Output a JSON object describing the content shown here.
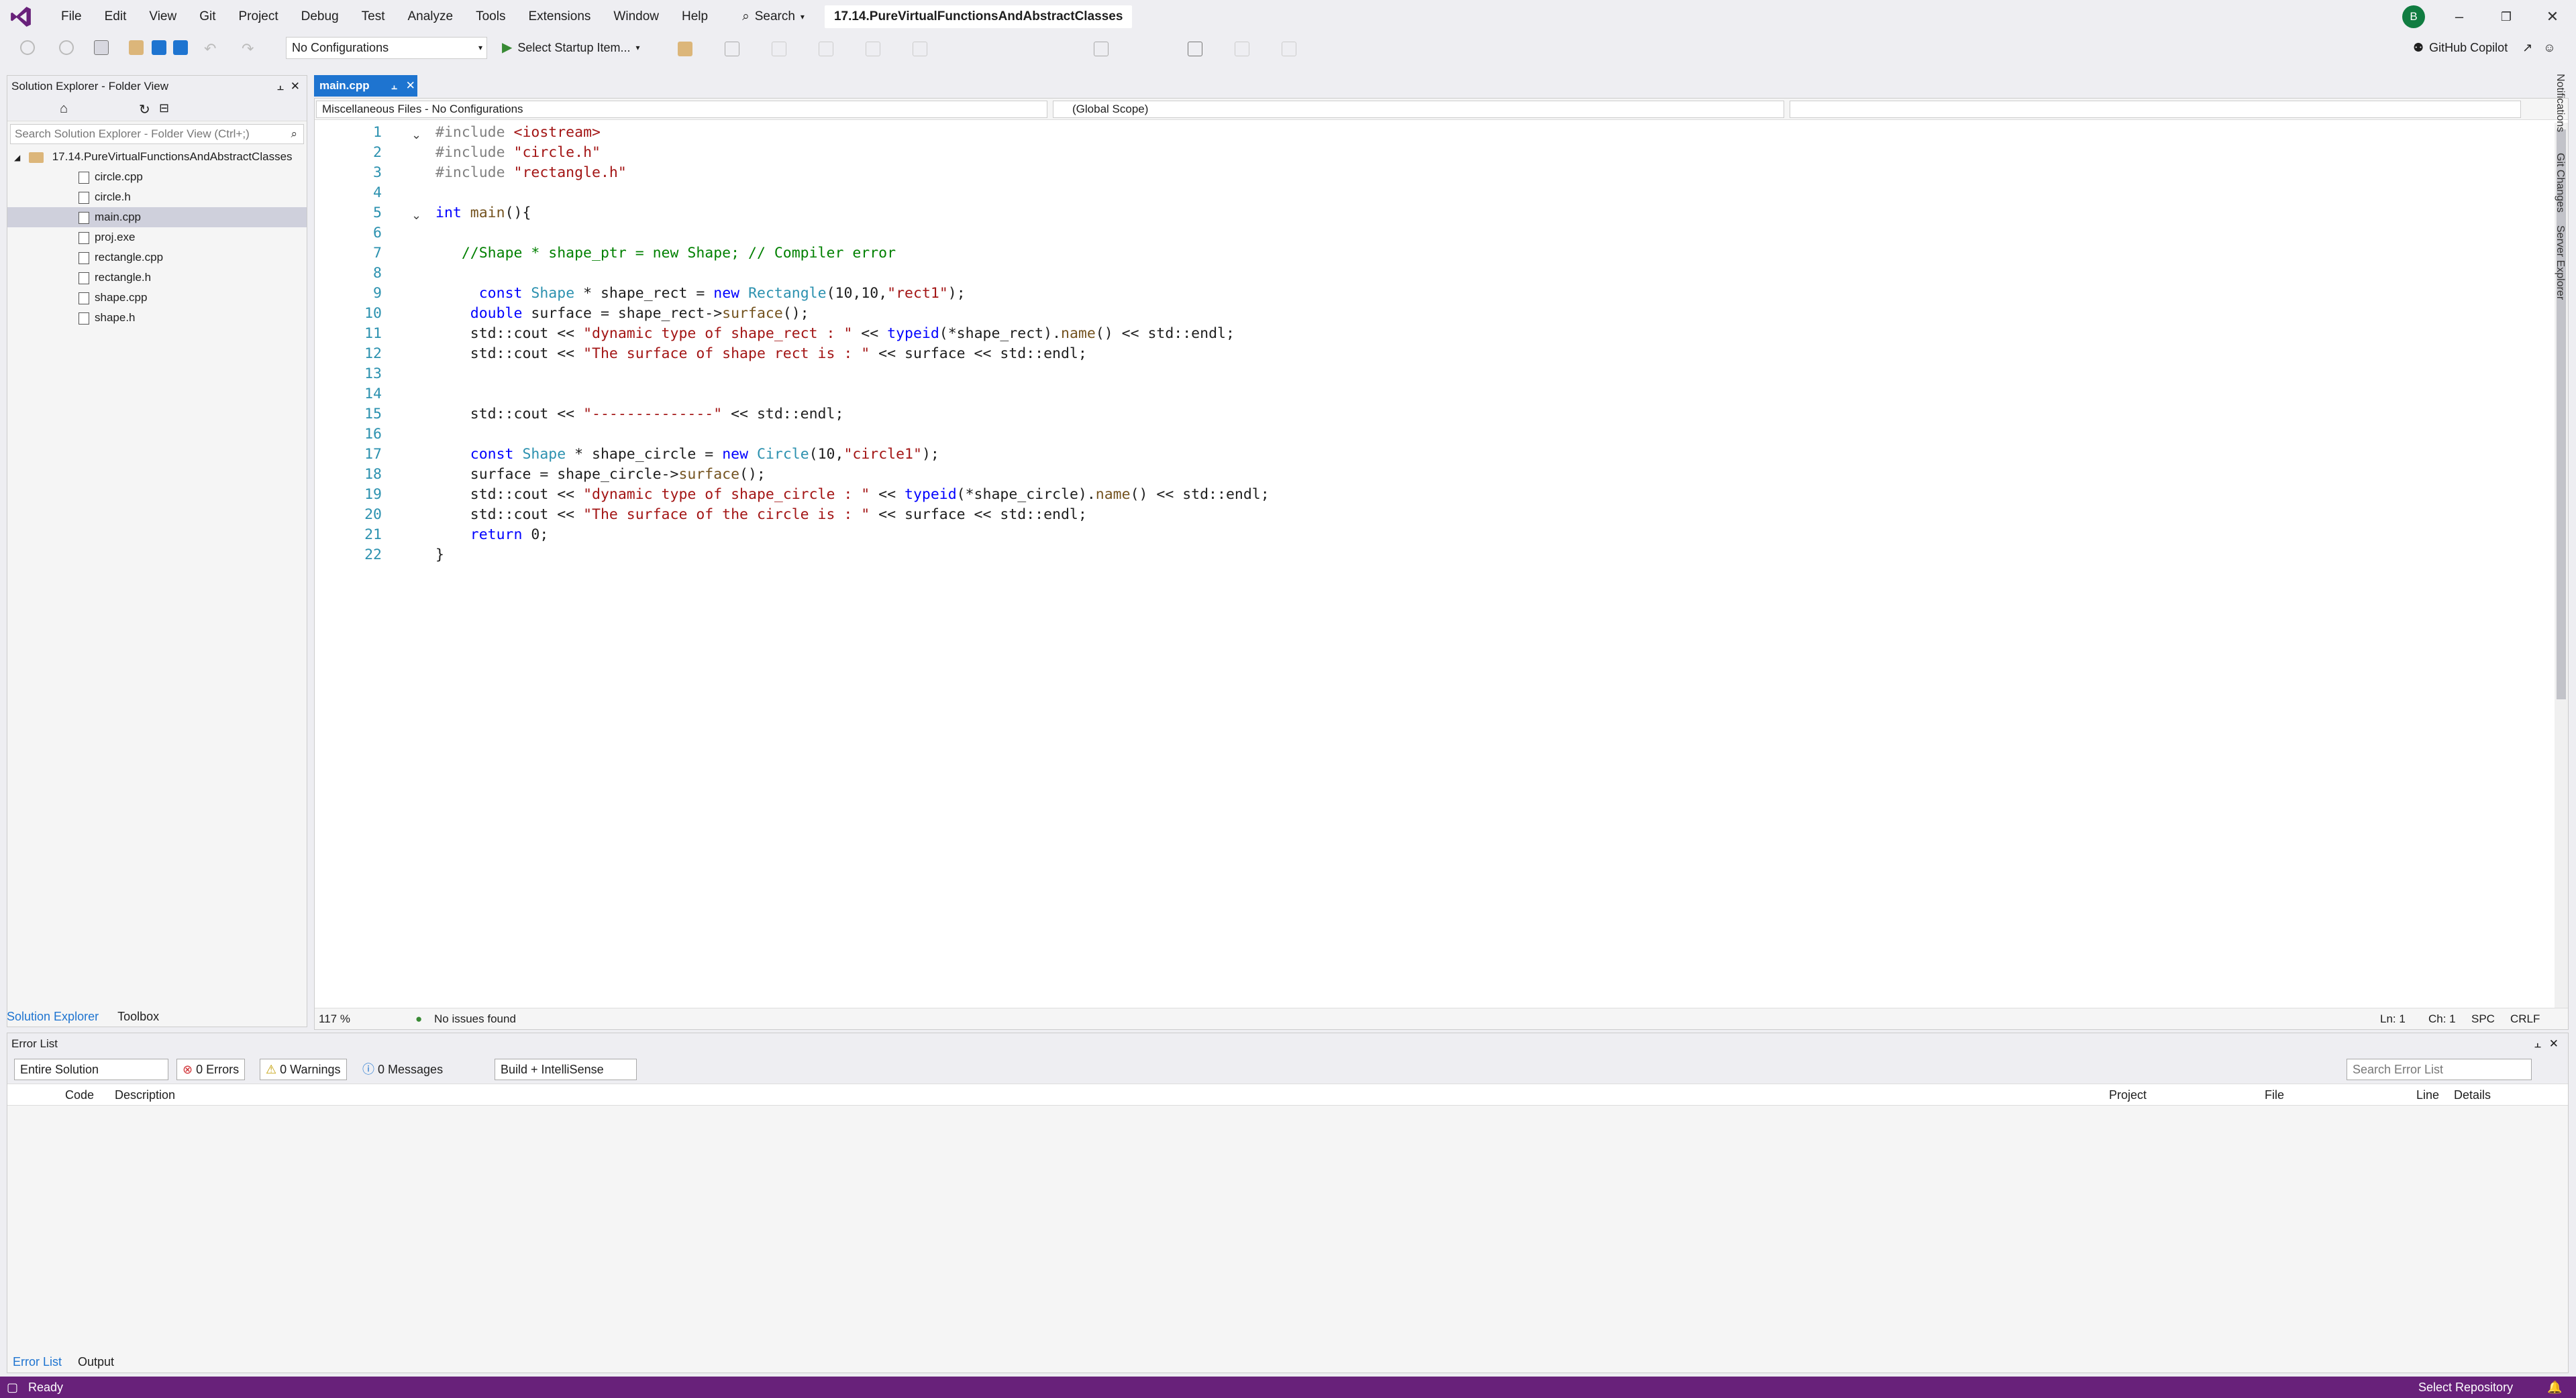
{
  "menu": {
    "items": [
      "File",
      "Edit",
      "View",
      "Git",
      "Project",
      "Debug",
      "Test",
      "Analyze",
      "Tools",
      "Extensions",
      "Window",
      "Help"
    ],
    "search_label": "Search",
    "solution_title": "17.14.PureVirtualFunctionsAndAbstractClasses",
    "avatar_initial": "B"
  },
  "toolbar": {
    "configuration": "No Configurations",
    "startup_label": "Select Startup Item...",
    "copilot_label": "GitHub Copilot"
  },
  "solution_explorer": {
    "title": "Solution Explorer - Folder View",
    "search_placeholder": "Search Solution Explorer - Folder View (Ctrl+;)",
    "root": "17.14.PureVirtualFunctionsAndAbstractClasses",
    "files": [
      {
        "name": "circle.cpp",
        "icon": "cpp-file-icon",
        "selected": false
      },
      {
        "name": "circle.h",
        "icon": "header-file-icon",
        "selected": false
      },
      {
        "name": "main.cpp",
        "icon": "cpp-file-icon",
        "selected": true
      },
      {
        "name": "proj.exe",
        "icon": "exe-file-icon",
        "selected": false
      },
      {
        "name": "rectangle.cpp",
        "icon": "cpp-file-icon",
        "selected": false
      },
      {
        "name": "rectangle.h",
        "icon": "header-file-icon",
        "selected": false
      },
      {
        "name": "shape.cpp",
        "icon": "cpp-file-icon",
        "selected": false
      },
      {
        "name": "shape.h",
        "icon": "header-file-icon",
        "selected": false
      }
    ],
    "bottom_tabs": [
      "Solution Explorer",
      "Toolbox"
    ]
  },
  "editor": {
    "tab_label": "main.cpp",
    "nav_project": "Miscellaneous Files - No Configurations",
    "nav_scope": "(Global Scope)",
    "nav_member": "",
    "lines": [
      {
        "n": "1",
        "html": "<span class=\"pp\">#include</span> <span class=\"str\">&lt;iostream&gt;</span>"
      },
      {
        "n": "2",
        "html": "<span class=\"pp\">#include</span> <span class=\"str\">\"circle.h\"</span>"
      },
      {
        "n": "3",
        "html": "<span class=\"pp\">#include</span> <span class=\"str\">\"rectangle.h\"</span>"
      },
      {
        "n": "4",
        "html": ""
      },
      {
        "n": "5",
        "html": "<span class=\"kw\">int</span> <span class=\"fn\">main</span>(){"
      },
      {
        "n": "6",
        "html": ""
      },
      {
        "n": "7",
        "html": "   <span class=\"cm\">//Shape * shape_ptr = new Shape; // Compiler error</span>"
      },
      {
        "n": "8",
        "html": ""
      },
      {
        "n": "9",
        "html": "     <span class=\"kw\">const</span> <span class=\"ty\">Shape</span> * shape_rect = <span class=\"kw\">new</span> <span class=\"ty\">Rectangle</span>(10,10,<span class=\"str\">\"rect1\"</span>);"
      },
      {
        "n": "10",
        "html": "    <span class=\"kw\">double</span> surface = shape_rect-&gt;<span class=\"fn\">surface</span>();"
      },
      {
        "n": "11",
        "html": "    std::cout &lt;&lt; <span class=\"str\">\"dynamic type of shape_rect : \"</span> &lt;&lt; <span class=\"kw\">typeid</span>(*shape_rect).<span class=\"fn\">name</span>() &lt;&lt; std::endl;"
      },
      {
        "n": "12",
        "html": "    std::cout &lt;&lt; <span class=\"str\">\"The surface of shape rect is : \"</span> &lt;&lt; surface &lt;&lt; std::endl;"
      },
      {
        "n": "13",
        "html": ""
      },
      {
        "n": "14",
        "html": ""
      },
      {
        "n": "15",
        "html": "    std::cout &lt;&lt; <span class=\"str\">\"--------------\"</span> &lt;&lt; std::endl;"
      },
      {
        "n": "16",
        "html": ""
      },
      {
        "n": "17",
        "html": "    <span class=\"kw\">const</span> <span class=\"ty\">Shape</span> * shape_circle = <span class=\"kw\">new</span> <span class=\"ty\">Circle</span>(10,<span class=\"str\">\"circle1\"</span>);"
      },
      {
        "n": "18",
        "html": "    surface = shape_circle-&gt;<span class=\"fn\">surface</span>();"
      },
      {
        "n": "19",
        "html": "    std::cout &lt;&lt; <span class=\"str\">\"dynamic type of shape_circle : \"</span> &lt;&lt; <span class=\"kw\">typeid</span>(*shape_circle).<span class=\"fn\">name</span>() &lt;&lt; std::endl;"
      },
      {
        "n": "20",
        "html": "    std::cout &lt;&lt; <span class=\"str\">\"The surface of the circle is : \"</span> &lt;&lt; surface &lt;&lt; std::endl;"
      },
      {
        "n": "21",
        "html": "    <span class=\"kw\">return</span> 0;"
      },
      {
        "n": "22",
        "html": "}"
      }
    ],
    "zoom": "117 %",
    "issues": "No issues found",
    "ln": "Ln: 1",
    "ch": "Ch: 1",
    "spc": "SPC",
    "crlf": "CRLF"
  },
  "error_list": {
    "title": "Error List",
    "scope": "Entire Solution",
    "errors": "0 Errors",
    "warnings": "0 Warnings",
    "messages": "0 Messages",
    "build_filter": "Build + IntelliSense",
    "search_placeholder": "Search Error List",
    "columns": [
      "Code",
      "Description",
      "Project",
      "File",
      "Line",
      "Details"
    ],
    "bottom_tabs": [
      "Error List",
      "Output"
    ]
  },
  "right_strip": [
    "Notifications",
    "Git Changes",
    "Server Explorer"
  ],
  "status": {
    "ready": "Ready",
    "repo": "Select Repository"
  },
  "colors": {
    "accent": "#1e74d0",
    "status_bar": "#68217a",
    "vs_purple": "#68217a"
  }
}
